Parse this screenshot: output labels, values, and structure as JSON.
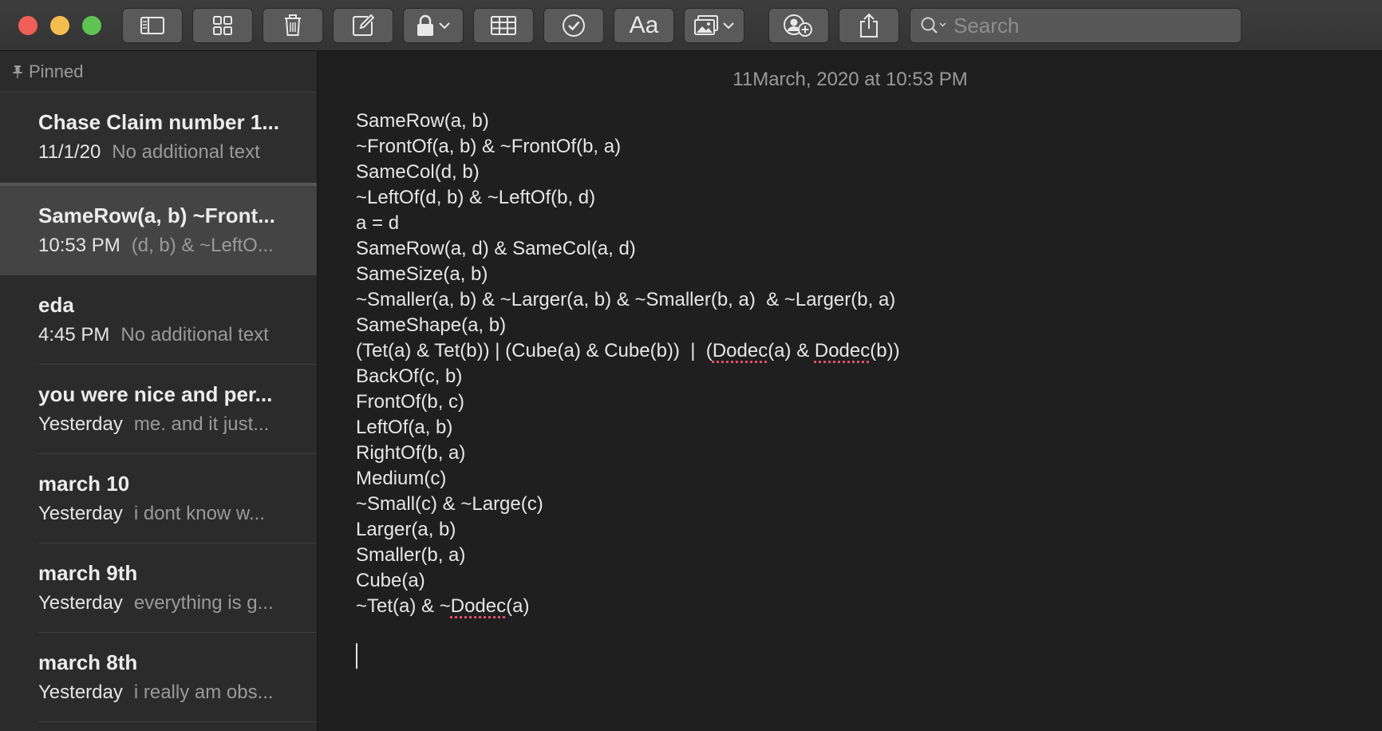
{
  "toolbar": {
    "search_placeholder": "Search",
    "font_button_label": "Aa"
  },
  "sidebar": {
    "pinned_label": "Pinned",
    "notes": [
      {
        "title": "Chase Claim number 1...",
        "date": "11/1/20",
        "preview": "No additional text"
      },
      {
        "title": "SameRow(a, b) ~Front...",
        "date": "10:53 PM",
        "preview": "(d, b) & ~LeftO..."
      },
      {
        "title": "eda",
        "date": "4:45 PM",
        "preview": "No additional text"
      },
      {
        "title": "you were nice and per...",
        "date": "Yesterday",
        "preview": "me. and it just..."
      },
      {
        "title": "march 10",
        "date": "Yesterday",
        "preview": "i dont know w..."
      },
      {
        "title": "march 9th",
        "date": "Yesterday",
        "preview": "everything is g..."
      },
      {
        "title": "march 8th",
        "date": "Yesterday",
        "preview": "i really am obs..."
      }
    ]
  },
  "editor": {
    "date": "11March, 2020 at 10:53 PM",
    "lines": [
      "SameRow(a, b)",
      "~FrontOf(a, b) & ~FrontOf(b, a)",
      "SameCol(d, b)",
      "~LeftOf(d, b) & ~LeftOf(b, d)",
      "a = d",
      "SameRow(a, d) & SameCol(a, d)",
      "SameSize(a, b)",
      "~Smaller(a, b) & ~Larger(a, b) & ~Smaller(b, a)  & ~Larger(b, a)",
      "SameShape(a, b)",
      "(Tet(a) & Tet(b)) | (Cube(a) & Cube(b))  |  (Dodec(a) & Dodec(b))",
      "BackOf(c, b)",
      "FrontOf(b, c)",
      "LeftOf(a, b)",
      "RightOf(b, a)",
      "Medium(c)",
      "~Small(c) & ~Large(c)",
      "Larger(a, b)",
      "Smaller(b, a)",
      "Cube(a)",
      "~Tet(a) & ~Dodec(a)"
    ],
    "spellcheck_words": [
      "Dodec"
    ]
  }
}
